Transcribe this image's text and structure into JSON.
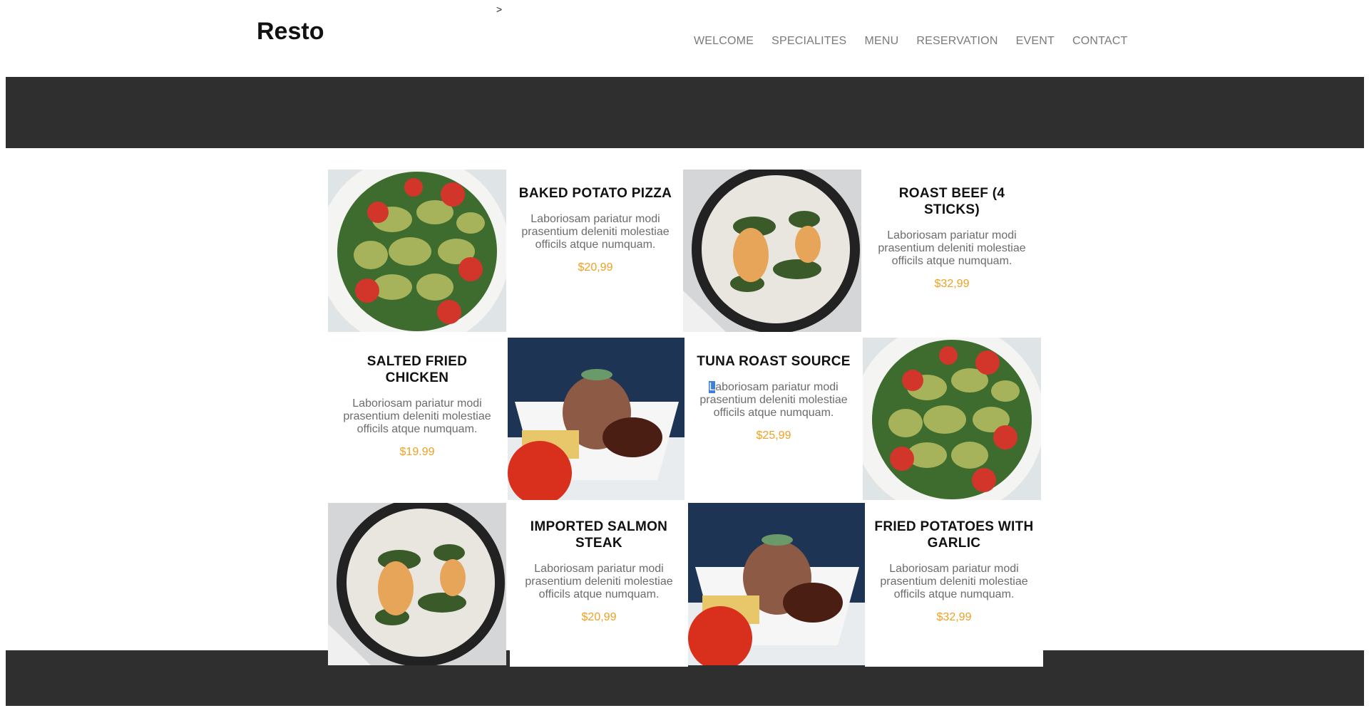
{
  "header": {
    "logo": "Resto",
    "stray_glyph": ">",
    "nav": [
      "WELCOME",
      "SPECIALITES",
      "MENU",
      "RESERVATION",
      "EVENT",
      "CONTACT"
    ]
  },
  "menu_items": [
    {
      "title": "BAKED POTATO PIZZA",
      "desc": "Laboriosam pariatur modi prasentium deleniti molestiae officils atque numquam.",
      "price": "$20,99"
    },
    {
      "title": "ROAST BEEF (4 STICKS)",
      "desc": "Laboriosam pariatur modi prasentium deleniti molestiae officils atque numquam.",
      "price": "$32,99"
    },
    {
      "title": "SALTED FRIED CHICKEN",
      "desc": "Laboriosam pariatur modi prasentium deleniti molestiae officils atque numquam.",
      "price": "$19.99"
    },
    {
      "title": "TUNA ROAST SOURCE",
      "desc_first": "L",
      "desc_rest": "aboriosam pariatur modi prasentium deleniti molestiae officils atque numquam.",
      "price": "$25,99"
    },
    {
      "title": "IMPORTED SALMON STEAK",
      "desc": "Laboriosam pariatur modi prasentium deleniti molestiae officils atque numquam.",
      "price": "$20,99"
    },
    {
      "title": "FRIED POTATOES WITH GARLIC",
      "desc": "Laboriosam pariatur modi prasentium deleniti molestiae officils atque numquam.",
      "price": "$32,99"
    }
  ],
  "colors": {
    "dark_band": "#2f2f2f",
    "price": "#f0a020",
    "nav_text": "#7a7a7a"
  },
  "images": [
    "pasta-salad-photo",
    "fish-skillet-photo",
    "rice-plate-photo"
  ]
}
